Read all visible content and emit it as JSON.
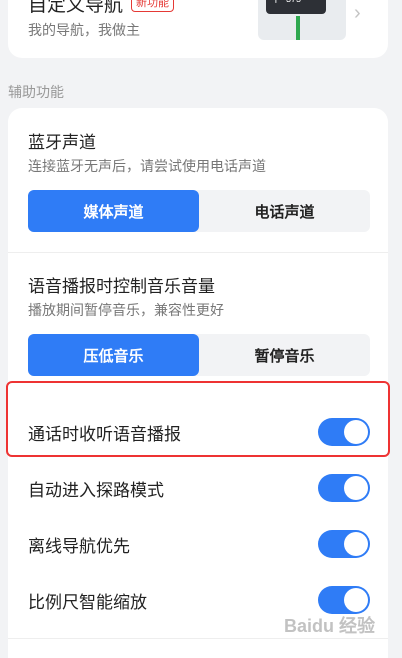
{
  "custom_nav": {
    "title": "自定义导航",
    "badge": "新功能",
    "subtitle": "我的导航，我做主",
    "thumb_distance": "375"
  },
  "section": {
    "title": "辅助功能"
  },
  "bluetooth": {
    "title": "蓝牙声道",
    "desc": "连接蓝牙无声后，请尝试使用电话声道",
    "options": [
      "媒体声道",
      "电话声道"
    ],
    "selected": "媒体声道"
  },
  "music": {
    "title": "语音播报时控制音乐音量",
    "desc": "播放期间暂停音乐，兼容性更好",
    "options": [
      "压低音乐",
      "暂停音乐"
    ],
    "selected": "压低音乐"
  },
  "toggles": [
    {
      "label": "通话时收听语音播报",
      "on": true
    },
    {
      "label": "自动进入探路模式",
      "on": true
    },
    {
      "label": "离线导航优先",
      "on": true
    },
    {
      "label": "比例尺智能缩放",
      "on": true
    }
  ],
  "watermark": "Baidu 经验",
  "colors": {
    "accent": "#2f7cf6",
    "highlight": "#e33333"
  }
}
